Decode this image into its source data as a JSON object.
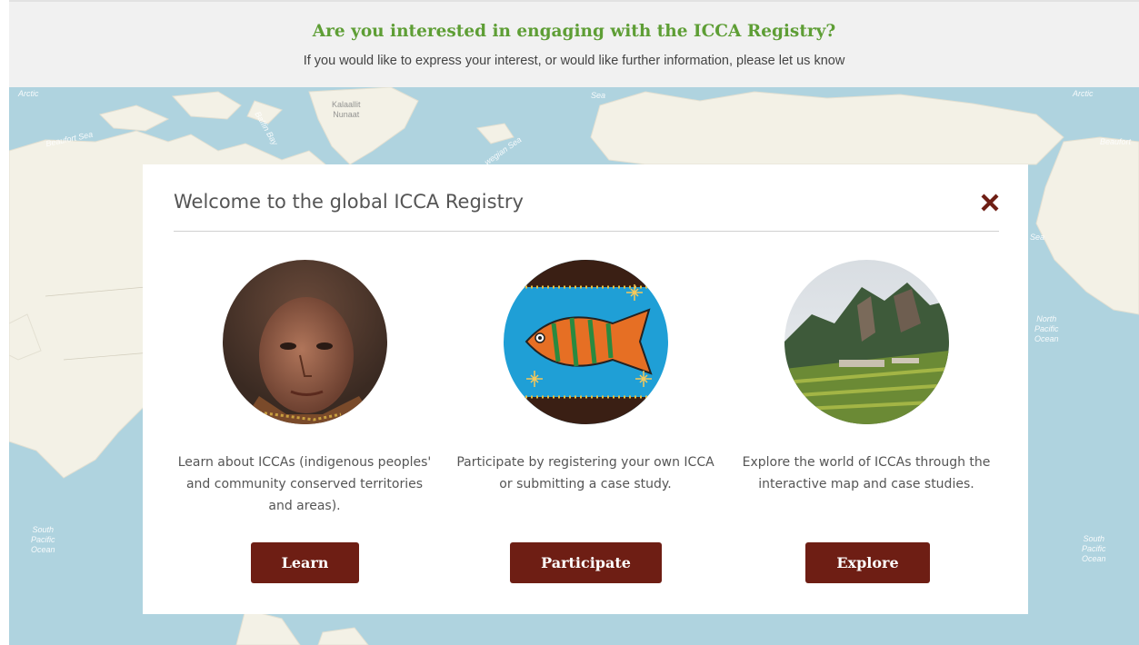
{
  "banner": {
    "title": "Are you interested in engaging with the ICCA Registry?",
    "subtitle": "If you would like to express your interest, or would like further information, please let us know"
  },
  "map": {
    "labels": {
      "arctic_left": "Arctic",
      "beaufort_left": "Beaufort Sea",
      "baffin": "Baffin Bay",
      "kalaallit": "Kalaallit\nNunaat",
      "norwegian": "wegian Sea",
      "sea_top": "Sea",
      "arctic_right": "Arctic",
      "beaufort_right": "Beaufort",
      "north_pacific": "North\nPacific\nOcean",
      "south_pacific_left": "South\nPacific\nOcean",
      "south_pacific_right": "South\nPacific\nOcean",
      "sea_right": "Sea"
    }
  },
  "modal": {
    "title": "Welcome to the global ICCA Registry",
    "close_icon": "close-x-icon",
    "columns": [
      {
        "description": "Learn about ICCAs (indigenous peoples' and community conserved territories and areas).",
        "button": "Learn",
        "image": "woman-portrait"
      },
      {
        "description": "Participate by registering your own ICCA or submitting a case study.",
        "button": "Participate",
        "image": "fish-painting"
      },
      {
        "description": "Explore the world of ICCAs through the interactive map and case studies.",
        "button": "Explore",
        "image": "mountain-landscape"
      }
    ]
  },
  "colors": {
    "banner_title": "#5e9e35",
    "button": "#6e1e14",
    "map_water": "#afd3df",
    "map_land": "#f3f1e6"
  }
}
